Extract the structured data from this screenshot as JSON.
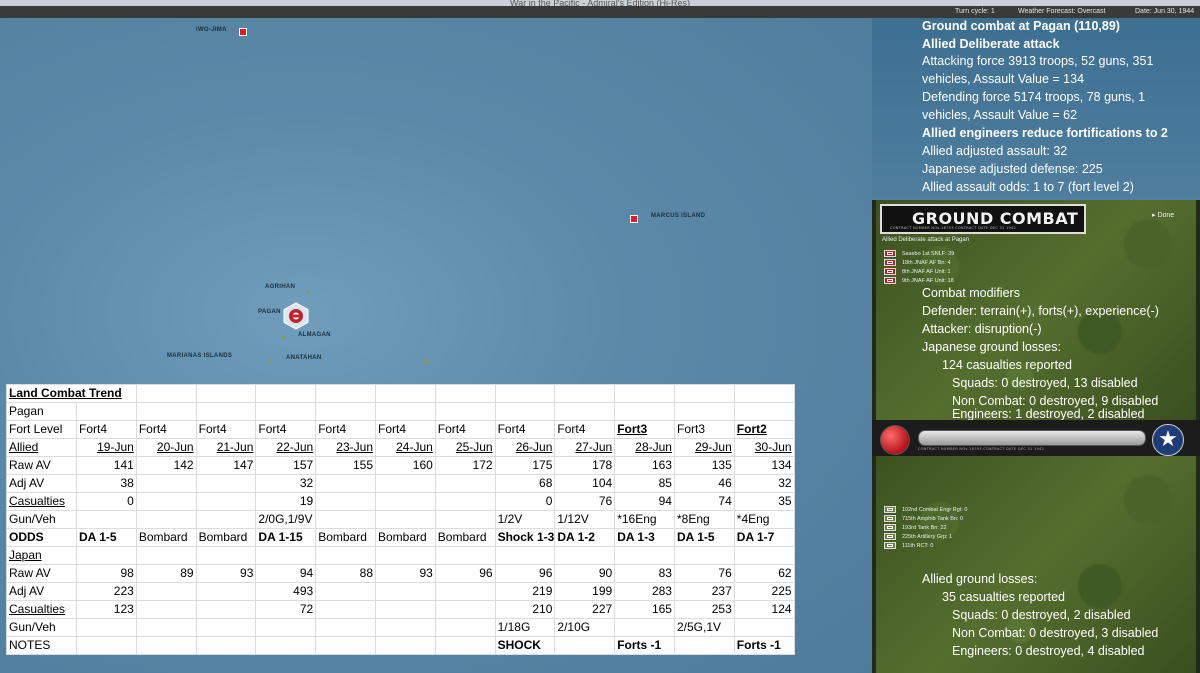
{
  "titlebar": "War in the Pacific - Admiral's Edition (Hi-Res)",
  "status": {
    "turn": "Turn cycle: 1",
    "weather": "Weather Forecast: Overcast",
    "date": "Date: Jun 30, 1944"
  },
  "map": {
    "labels": {
      "iwo_jima": "IWO-JIMA",
      "marcus": "MARCUS ISLAND",
      "agrihan": "AGRIHAN",
      "pagan": "PAGAN",
      "almagan": "ALMAGAN",
      "marianas": "MARIANAS ISLANDS",
      "anatahan": "ANATAHAN"
    }
  },
  "report": {
    "line1": "Ground combat at Pagan (110,89)",
    "line2": "Allied Deliberate attack",
    "line3": "Attacking force 3913 troops, 52 guns, 351",
    "line4": "vehicles, Assault Value = 134",
    "line5": "Defending force 5174 troops, 78 guns, 1",
    "line6": "vehicles, Assault Value = 62",
    "line7": "Allied engineers reduce fortifications to 2",
    "line8": "Allied adjusted assault: 32",
    "line9": "Japanese adjusted defense: 225",
    "line10": "Allied assault odds: 1 to 7 (fort level 2)"
  },
  "panel": {
    "title": "GROUND COMBAT",
    "done": "Done",
    "subtitle": "Allied Deliberate attack at Pagan",
    "contract": "CONTRACT NUMBER NOs-18793     CONTRACT DATE DEC 31 1942",
    "defender_units": [
      "Sasebo 1st SNLF: 39",
      "18th JNAF AF Bn: 4",
      "8th JNAF AF Unit: 1",
      "9th JNAF AF Unit: 18"
    ],
    "modifiers_title": "Combat modifiers",
    "defender_mod": "Defender: terrain(+), forts(+), experience(-)",
    "attacker_mod": "Attacker: disruption(-)",
    "jp_losses_title": "Japanese ground losses:",
    "jp_casualties": "124 casualties reported",
    "jp_squads": "Squads: 0 destroyed, 13 disabled",
    "jp_noncombat": "Non Combat: 0 destroyed, 9 disabled",
    "jp_engineers": "Engineers: 1 destroyed, 2 disabled",
    "attacker_units": [
      "102nd Combat Engr Rgt: 0",
      "715th Amphib Tank Bn: 0",
      "193rd Tank Bn: 22",
      "225th Artillery Grp: 1",
      "111th RCT: 0"
    ],
    "al_losses_title": "Allied ground losses:",
    "al_casualties": "35 casualties reported",
    "al_squads": "Squads: 0 destroyed, 2 disabled",
    "al_noncombat": "Non Combat: 0 destroyed, 3 disabled",
    "al_engineers": "Engineers: 0 destroyed, 4 disabled"
  },
  "trend": {
    "title": "Land Combat Trend",
    "location": "Pagan",
    "rows": [
      {
        "label": "Fort Level",
        "label_style": "",
        "align": "left",
        "cells": [
          "Fort4",
          "Fort4",
          "Fort4",
          "Fort4",
          "Fort4",
          "Fort4",
          "Fort4",
          "Fort4",
          "Fort4",
          "Fort3",
          "Fort3",
          "Fort2"
        ],
        "styles": [
          "",
          "",
          "",
          "",
          "",
          "",
          "",
          "",
          "",
          "ub",
          "",
          "ub"
        ]
      },
      {
        "label": "Allied",
        "label_style": "u",
        "align": "right",
        "cells": [
          "19-Jun",
          "20-Jun",
          "21-Jun",
          "22-Jun",
          "23-Jun",
          "24-Jun",
          "25-Jun",
          "26-Jun",
          "27-Jun",
          "28-Jun",
          "29-Jun",
          "30-Jun"
        ],
        "styles": [
          "u",
          "u",
          "u",
          "u",
          "u",
          "u",
          "u",
          "u",
          "u",
          "u",
          "u",
          "u"
        ]
      },
      {
        "label": "Raw AV",
        "label_style": "",
        "align": "right",
        "cells": [
          "141",
          "142",
          "147",
          "157",
          "155",
          "160",
          "172",
          "175",
          "178",
          "163",
          "135",
          "134"
        ]
      },
      {
        "label": "Adj AV",
        "label_style": "",
        "align": "right",
        "cells": [
          "38",
          "",
          "",
          "32",
          "",
          "",
          "",
          "68",
          "104",
          "85",
          "46",
          "32"
        ]
      },
      {
        "label": "Casualties",
        "label_style": "u",
        "align": "right",
        "cells": [
          "0",
          "",
          "",
          "19",
          "",
          "",
          "",
          "0",
          "76",
          "94",
          "74",
          "35"
        ]
      },
      {
        "label": "Gun/Veh",
        "label_style": "",
        "align": "left",
        "cells": [
          "",
          "",
          "",
          "2/0G,1/9V",
          "",
          "",
          "",
          "1/2V",
          "1/12V",
          "*16Eng",
          "*8Eng",
          "*4Eng"
        ]
      },
      {
        "label": "ODDS",
        "label_style": "b",
        "align": "left",
        "cells": [
          "DA 1-5",
          "Bombard",
          "Bombard",
          "DA 1-15",
          "Bombard",
          "Bombard",
          "Bombard",
          "Shock 1-3",
          "DA 1-2",
          "DA 1-3",
          "DA 1-5",
          "DA 1-7"
        ],
        "styles": [
          "b",
          "",
          "",
          "b",
          "",
          "",
          "",
          "b",
          "b",
          "b",
          "b",
          "b"
        ]
      },
      {
        "label": "Japan",
        "label_style": "u",
        "align": "right",
        "cells": [
          "",
          "",
          "",
          "",
          "",
          "",
          "",
          "",
          "",
          "",
          "",
          ""
        ]
      },
      {
        "label": "Raw AV",
        "label_style": "",
        "align": "right",
        "cells": [
          "98",
          "89",
          "93",
          "94",
          "88",
          "93",
          "96",
          "96",
          "90",
          "83",
          "76",
          "62"
        ]
      },
      {
        "label": "Adj AV",
        "label_style": "",
        "align": "right",
        "cells": [
          "223",
          "",
          "",
          "493",
          "",
          "",
          "",
          "219",
          "199",
          "283",
          "237",
          "225"
        ]
      },
      {
        "label": "Casualties",
        "label_style": "u",
        "align": "right",
        "cells": [
          "123",
          "",
          "",
          "72",
          "",
          "",
          "",
          "210",
          "227",
          "165",
          "253",
          "124"
        ]
      },
      {
        "label": "Gun/Veh",
        "label_style": "",
        "align": "left",
        "cells": [
          "",
          "",
          "",
          "",
          "",
          "",
          "",
          "1/18G",
          "2/10G",
          "",
          "2/5G,1V",
          ""
        ]
      },
      {
        "label": "NOTES",
        "label_style": "",
        "align": "left",
        "cells": [
          "",
          "",
          "",
          "",
          "",
          "",
          "",
          "SHOCK",
          "",
          "Forts -1",
          "",
          "Forts -1"
        ],
        "styles": [
          "",
          "",
          "",
          "",
          "",
          "",
          "",
          "b",
          "",
          "b",
          "",
          "b"
        ]
      }
    ]
  },
  "colors": {
    "ocean": "#5b89a8",
    "report_bg": "#4a7a9b",
    "japan_marker": "#e01b24",
    "jungle": "#4a6328"
  }
}
